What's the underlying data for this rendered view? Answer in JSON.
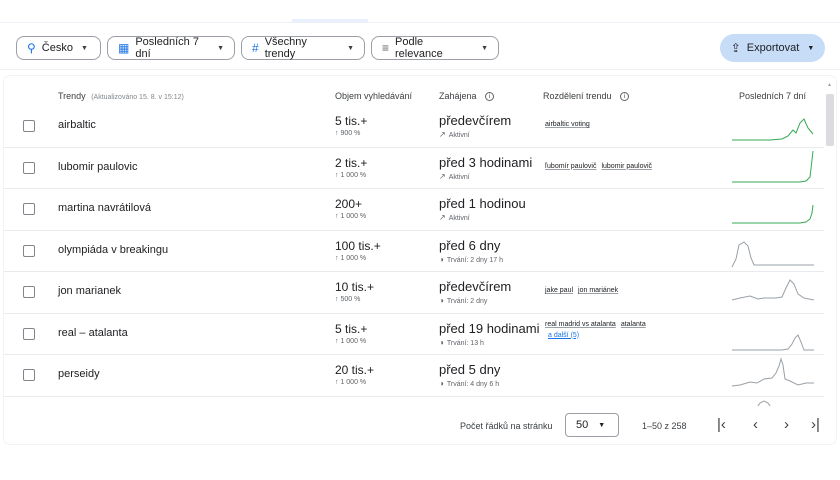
{
  "filters": {
    "location": "Česko",
    "period": "Posledních 7 dní",
    "trends": "Všechny trendy",
    "sort": "Podle relevance"
  },
  "export_label": "Exportovat",
  "table": {
    "col_trends": "Trendy",
    "col_trends_updated": "(Aktualizováno 15. 8. v 15:12)",
    "col_volume": "Objem vyhledávání",
    "col_started": "Zahájena",
    "col_breakdown": "Rozdělení trendu",
    "col_last7": "Posledních 7 dní"
  },
  "rows": [
    {
      "name": "airbaltic",
      "volume": "5 tis.+",
      "change": "↑ 900 %",
      "started": "předevčírem",
      "status": "Aktivní",
      "status_icon": "trending-up-icon",
      "breakdown": [
        "airbaltic voting"
      ],
      "more": ""
    },
    {
      "name": "lubomir paulovic",
      "volume": "2 tis.+",
      "change": "↑ 1 000 %",
      "started": "před 3 hodinami",
      "status": "Aktivní",
      "status_icon": "trending-up-icon",
      "breakdown": [
        "ľubomír paulovič",
        "lubomir paulovič"
      ],
      "more": ""
    },
    {
      "name": "martina navrátilová",
      "volume": "200+",
      "change": "↑ 1 000 %",
      "started": "před 1 hodinou",
      "status": "Aktivní",
      "status_icon": "trending-up-icon",
      "breakdown": [],
      "more": ""
    },
    {
      "name": "olympiáda v breakingu",
      "volume": "100 tis.+",
      "change": "↑ 1 000 %",
      "started": "před 6 dny",
      "status": "Trvání: 2 dny 17 h",
      "status_icon": "duration-icon",
      "breakdown": [],
      "more": ""
    },
    {
      "name": "jon marianek",
      "volume": "10 tis.+",
      "change": "↑ 500 %",
      "started": "předevčírem",
      "status": "Trvání: 2 dny",
      "status_icon": "duration-icon",
      "breakdown": [
        "jake paul",
        "jon mariánek"
      ],
      "more": ""
    },
    {
      "name": "real – atalanta",
      "volume": "5 tis.+",
      "change": "↑ 1 000 %",
      "started": "před 19 hodinami",
      "status": "Trvání: 13 h",
      "status_icon": "duration-icon",
      "breakdown": [
        "real madrid vs atalanta",
        "atalanta"
      ],
      "more": "a další (5)"
    },
    {
      "name": "perseidy",
      "volume": "20 tis.+",
      "change": "↑ 1 000 %",
      "started": "před 5 dny",
      "status": "Trvání: 4 dny 6 h",
      "status_icon": "duration-icon",
      "breakdown": [],
      "more": ""
    }
  ],
  "sparkline_colors": {
    "active": "#34a853",
    "ended": "#9aa0a6"
  },
  "pagination": {
    "rows_per_page_label": "Počet řádků na stránku",
    "rows_per_page": "50",
    "range": "1–50 z 258"
  }
}
